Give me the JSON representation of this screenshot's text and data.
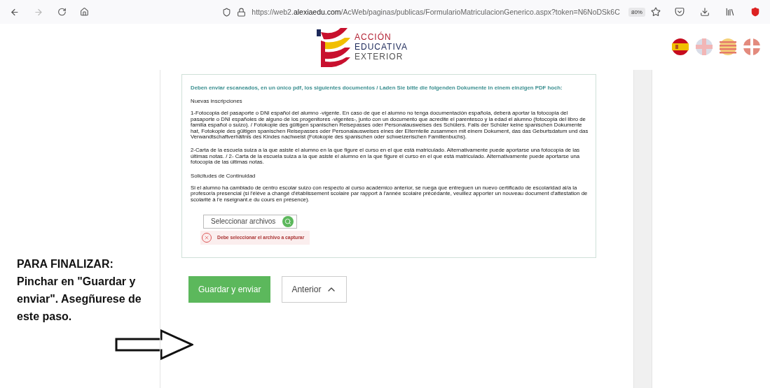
{
  "browser": {
    "url_prefix": "https://web2.",
    "url_domain": "alexiaedu.com",
    "url_path": "/AcWeb/paginas/publicas/FormularioMatriculacionGenerico.aspx?token=N6NoDSk6C",
    "zoom": "80%"
  },
  "header": {
    "logo_lines": [
      "ACCIÓN",
      "EDUCATIVA",
      "EXTERIOR"
    ]
  },
  "form": {
    "intro": "Deben enviar escaneados, en un único pdf, los siguientes documentos / Laden Sie bitte die folgenden Dokumente in einem einzigen PDF hoch:",
    "sections": [
      {
        "heading": "Nuevas inscripciones",
        "paragraphs": [
          "1-Fotocopia del pasaporte o DNI español del alumno -vigente. En caso de que el alumno no tenga documentación española, deberá aportar la fotocopia del pasaporte o DNI españoles de alguno de los progenitores -vigentes-, junto con un documento que acredite el parentesco y la edad el alumno (fotocopia del libro de familia español o suizo). / Fotokopie des gültigen spanischen Reisepasses oder Personalausweises des Schülers. Falls der Schüler keine spanischen Dokumente hat, Fotokopie des gültigen spanischen Reisepasses oder Personalausweises eines der Elternteile zusammen mit einem Dokument, das das Geburtsdatum und das Verwandtschaftverhältnis des Kindes nachweist (Fotokopie des spanischen oder schweizerischen Familienbuchs).",
          "2-Carta de la escuela suiza a la que asiste el alumno en la que figure el curso en el que está matriculado. Alternativamente puede aportarse una fotocopia de las últimas notas. / 2- Carta de la escuela suiza a la que asiste el alumno en la que figure el curso en el que está matriculado. Alternativamente puede aportarse una fotocopia de las últimas notas."
        ]
      },
      {
        "heading": "Solicitudes de Continuidad",
        "paragraphs": [
          "Si el alumno ha cambiado de centro escolar suizo con respecto al curso académico anterior, se ruega que entreguen un nuevo certificado de escolaridad al/a la profesor/a presencial (si l'élève a changé d'établissement scolaire par rapport à l'année scolaire précédante, veuillez apporter un nouveau document d'attestation de scolarité à l'e nseignant.e du cours en présence)."
        ]
      }
    ],
    "file_button": "Seleccionar archivos",
    "error": "Debe seleccionar el archivo a capturar"
  },
  "buttons": [
    {
      "label": "Guardar y enviar",
      "kind": "primary"
    },
    {
      "label": "Anterior",
      "kind": "secondary"
    }
  ],
  "annotation": "PARA FINALIZAR: Pinchar en \"Guardar y enviar\". Asegñurese de este paso."
}
